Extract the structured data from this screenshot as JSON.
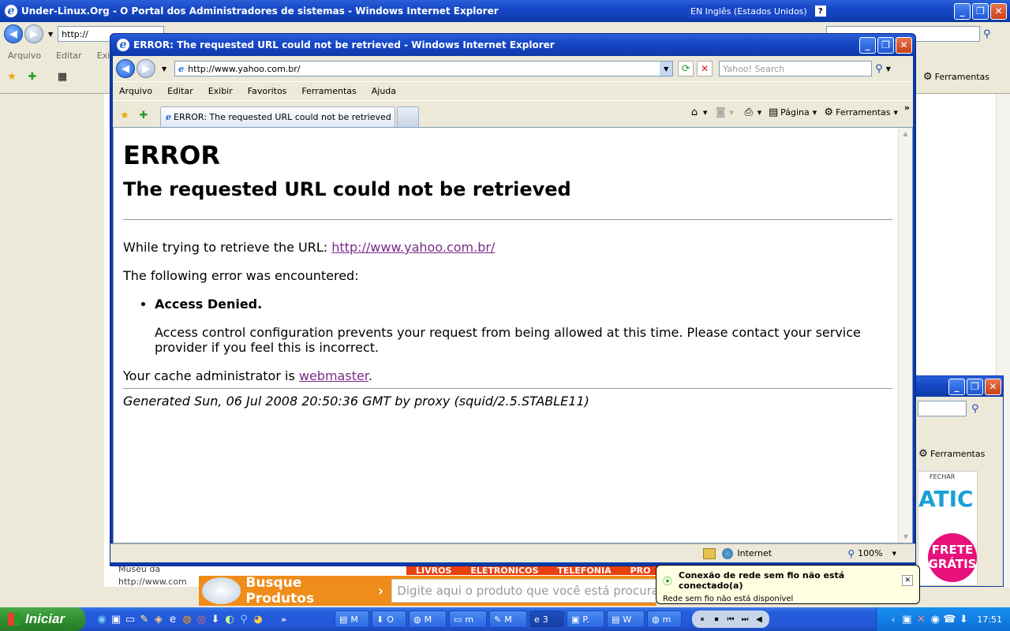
{
  "bg_window": {
    "title": "Under-Linux.Org - O Portal dos Administradores de sistemas - Windows Internet Explorer",
    "language": "EN Inglês (Estados Unidos)",
    "address": "http://",
    "search_placeholder": "Yahoo! Search",
    "menu": [
      "Arquivo",
      "Editar",
      "Exibir"
    ],
    "tools_label": "Ferramentas",
    "left_url": "http://www.com",
    "left_text": "Museu da",
    "busque_label": "Busque Produtos",
    "busque_placeholder": "Digite aqui o produto que você está procurando",
    "ad_tabs": [
      "LIVROS",
      "ELETRÔNICOS",
      "TELEFONIA",
      "PRO"
    ],
    "frete": "FRETE GRÁTIS",
    "fechar": "FECHAR",
    "atic": "ATIC"
  },
  "bg_window2": {
    "tools_label": "Ferramentas"
  },
  "window": {
    "title": "ERROR: The requested URL could not be retrieved - Windows Internet Explorer",
    "address": "http://www.yahoo.com.br/",
    "search_placeholder": "Yahoo! Search",
    "menu": [
      "Arquivo",
      "Editar",
      "Exibir",
      "Favoritos",
      "Ferramentas",
      "Ajuda"
    ],
    "tab_label": "ERROR: The requested URL could not be retrieved",
    "page_label": "Página",
    "tools_label": "Ferramentas",
    "status_zone": "Internet",
    "zoom": "100%"
  },
  "page": {
    "h1": "ERROR",
    "h2": "The requested URL could not be retrieved",
    "trying_prefix": "While trying to retrieve the URL: ",
    "trying_url": "http://www.yahoo.com.br/",
    "encountered": "The following error was encountered:",
    "error_title": "Access Denied.",
    "error_desc": "Access control configuration prevents your request from being allowed at this time. Please contact your service provider if you feel this is incorrect.",
    "cache_prefix": "Your cache administrator is ",
    "cache_link": "webmaster",
    "cache_suffix": ".",
    "generated": "Generated Sun, 06 Jul 2008 20:50:36 GMT by proxy (squid/2.5.STABLE11)"
  },
  "balloon": {
    "title": "Conexão de rede sem fio não está conectado(a)",
    "text": "Rede sem fio não está disponível"
  },
  "taskbar": {
    "start": "Iniciar",
    "tasks": [
      "M",
      "O",
      "M",
      "m",
      "M",
      "3",
      "P.",
      "W",
      "m"
    ],
    "clock": "17:51"
  }
}
